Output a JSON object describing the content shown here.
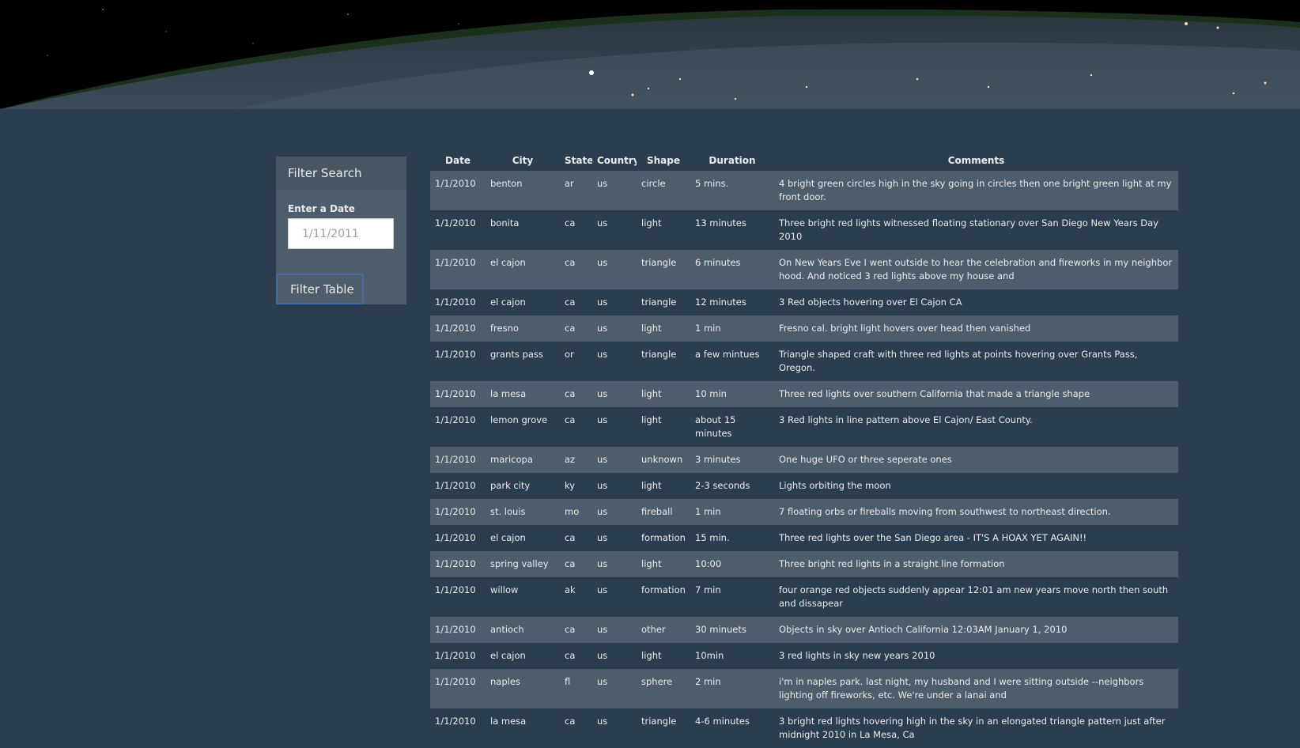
{
  "filter": {
    "heading": "Filter Search",
    "label": "Enter a Date",
    "placeholder": "1/11/2011",
    "button_label": "Filter Table"
  },
  "table": {
    "headers": [
      "Date",
      "City",
      "State",
      "Country",
      "Shape",
      "Duration",
      "Comments"
    ],
    "rows": [
      [
        "1/1/2010",
        "benton",
        "ar",
        "us",
        "circle",
        "5 mins.",
        "4 bright green circles high in the sky going in circles then one bright green light at my front door."
      ],
      [
        "1/1/2010",
        "bonita",
        "ca",
        "us",
        "light",
        "13 minutes",
        "Three bright red lights witnessed floating stationary over San Diego New Years Day 2010"
      ],
      [
        "1/1/2010",
        "el cajon",
        "ca",
        "us",
        "triangle",
        "6 minutes",
        "On New Years Eve I went outside to hear the celebration and fireworks in my neighbor hood. And noticed 3 red lights above my house and"
      ],
      [
        "1/1/2010",
        "el cajon",
        "ca",
        "us",
        "triangle",
        "12 minutes",
        "3 Red objects hovering over El Cajon CA"
      ],
      [
        "1/1/2010",
        "fresno",
        "ca",
        "us",
        "light",
        "1 min",
        "Fresno cal. bright light hovers over head then vanished"
      ],
      [
        "1/1/2010",
        "grants pass",
        "or",
        "us",
        "triangle",
        "a few mintues",
        "Triangle shaped craft with three red lights at points hovering over Grants Pass, Oregon."
      ],
      [
        "1/1/2010",
        "la mesa",
        "ca",
        "us",
        "light",
        "10 min",
        "Three red lights over southern California that made a triangle shape"
      ],
      [
        "1/1/2010",
        "lemon grove",
        "ca",
        "us",
        "light",
        "about 15 minutes",
        "3 Red lights in line pattern above El Cajon/ East County."
      ],
      [
        "1/1/2010",
        "maricopa",
        "az",
        "us",
        "unknown",
        "3 minutes",
        "One huge UFO or three seperate ones"
      ],
      [
        "1/1/2010",
        "park city",
        "ky",
        "us",
        "light",
        "2-3 seconds",
        "Lights orbiting the moon"
      ],
      [
        "1/1/2010",
        "st. louis",
        "mo",
        "us",
        "fireball",
        "1 min",
        "7 floating orbs or fireballs moving from southwest to northeast direction."
      ],
      [
        "1/1/2010",
        "el cajon",
        "ca",
        "us",
        "formation",
        "15 min.",
        "Three red lights over the San Diego area - IT'S A HOAX YET AGAIN!!"
      ],
      [
        "1/1/2010",
        "spring valley",
        "ca",
        "us",
        "light",
        "10:00",
        "Three bright red lights in a straight line formation"
      ],
      [
        "1/1/2010",
        "willow",
        "ak",
        "us",
        "formation",
        "7 min",
        "four orange red objects suddenly appear 12:01 am new years move north then south and dissapear"
      ],
      [
        "1/1/2010",
        "antioch",
        "ca",
        "us",
        "other",
        "30 minuets",
        "Objects in sky over Antioch California 12:03AM January 1, 2010"
      ],
      [
        "1/1/2010",
        "el cajon",
        "ca",
        "us",
        "light",
        "10min",
        "3 red lights in sky new years 2010"
      ],
      [
        "1/1/2010",
        "naples",
        "fl",
        "us",
        "sphere",
        "2 min",
        "i'm in naples park. last night, my husband and I were sitting outside --neighbors lighting off fireworks, etc. We're under a lanai and"
      ],
      [
        "1/1/2010",
        "la mesa",
        "ca",
        "us",
        "triangle",
        "4-6 minutes",
        "3 bright red lights hovering high in the sky in an elongated triangle pattern just after midnight 2010 in La Mesa, Ca"
      ]
    ]
  }
}
